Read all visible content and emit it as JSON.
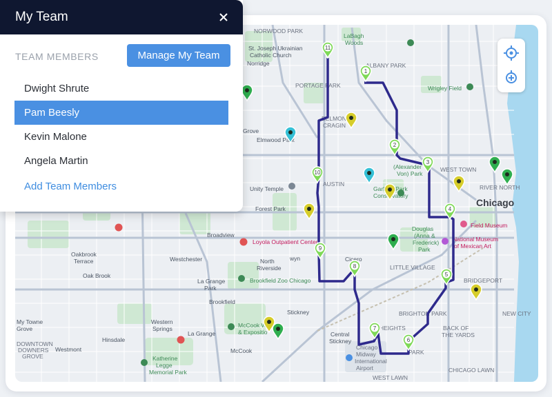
{
  "panel": {
    "title": "My Team",
    "close_icon": "close-icon",
    "section_label": "TEAM MEMBERS",
    "manage_button": "Manage My Team",
    "members": [
      "Dwight Shrute",
      "Pam Beesly",
      "Kevin Malone",
      "Angela Martin"
    ],
    "selected_member": "Pam Beesly",
    "add_link": "Add Team Members"
  },
  "map": {
    "controls": [
      "crosshair-icon",
      "recenter-icon"
    ],
    "city_label": "Chicago",
    "labels": {
      "norwood_park": "NORWOOD PARK",
      "la_bagh_woods": "LaBagh",
      "la_bagh_woods2": "Woods",
      "st_joseph": "St. Joseph Ukrainian",
      "st_joseph2": "Catholic Church",
      "norridge": "Norridge",
      "albany_park": "ALBANY PARK",
      "portage_park": "PORTAGE PARK",
      "wrigley_field": "Wrigley Field",
      "grove": "Grove",
      "elmwood_park": "Elmwood Park",
      "belmont_cragin": "BELMONT",
      "belmont_cragin2": "CRAGIN",
      "alexander_von": "(Alexander",
      "alexander_von2": "Von) Park",
      "west_town": "WEST TOWN",
      "river_north": "RIVER NORTH",
      "unity_temple": "Unity Temple",
      "austin": "AUSTIN",
      "garfield_park": "Garfield Park",
      "garfield_park2": "Conservatory",
      "forest_park": "Forest Park",
      "field_museum": "Field Museum",
      "douglas_park": "Douglas",
      "douglas_park2": "(Anna &",
      "douglas_park3": "Frederick)",
      "douglas_park4": "Park",
      "national_museum": "National Museum",
      "national_museum2": "of Mexican Art",
      "broadview": "Broadview",
      "loyola": "Loyola Outpatient Center",
      "oakbrook_terrace": "Oakbrook",
      "oakbrook_terrace2": "Terrace",
      "westchester": "Westchester",
      "north_riverside": "North",
      "north_riverside2": "Riverside",
      "berwyn": "wyn",
      "cicero": "Cicero",
      "little_village": "LITTLE VILLAGE",
      "oak_brook": "Oak Brook",
      "la_grange_park": "La Grange",
      "la_grange_park2": "Park",
      "brookfield_zoo": "Brookfield Zoo Chicago",
      "bridgeport": "BRIDGEPORT",
      "brookfield": "Brookfield",
      "stickney": "Stickney",
      "brighton_park": "BRIGHTON PARK",
      "my_towne_grove": "My Towne",
      "my_towne_grove2": "Grove",
      "western_springs": "Western",
      "western_springs2": "Springs",
      "la_grange": "La Grange",
      "mccook_expo": "McCook Woods",
      "mccook_expo2": "& Expositio",
      "archer_heights": "HEIGHTS",
      "back_of_yards": "BACK OF",
      "back_of_yards2": "THE YARDS",
      "new_city": "NEW CITY",
      "hinsdale": "Hinsdale",
      "central_stickney": "Central",
      "central_stickney2": "Stickney",
      "downtown_downers": "DOWNTOWN",
      "downtown_downers2": "DOWNERS",
      "downtown_downers3": "GROVE",
      "westmont": "Westmont",
      "mccook": "McCook",
      "katherine_legge": "Katherine",
      "katherine_legge2": "Legge",
      "katherine_legge3": "Memorial Park",
      "midway": "Chicago",
      "midway2": "Midway",
      "midway3": "International",
      "midway4": "Airport",
      "west_lawn": "WEST LAWN",
      "park_s": "PARK",
      "chicago_lawn": "CHICAGO LAWN"
    },
    "route_stops": [
      "1",
      "2",
      "3",
      "4",
      "5",
      "6",
      "7",
      "8",
      "9",
      "10",
      "11"
    ],
    "colors": {
      "route": "#2e2a8c",
      "stop_pin": "#7ed957",
      "green_pin": "#2fae4f",
      "yellow_pin": "#d6cd2a",
      "teal_pin": "#35c0d6",
      "water": "#a8d8f0",
      "panel_header": "#0f1730",
      "accent": "#4a90e2"
    }
  }
}
